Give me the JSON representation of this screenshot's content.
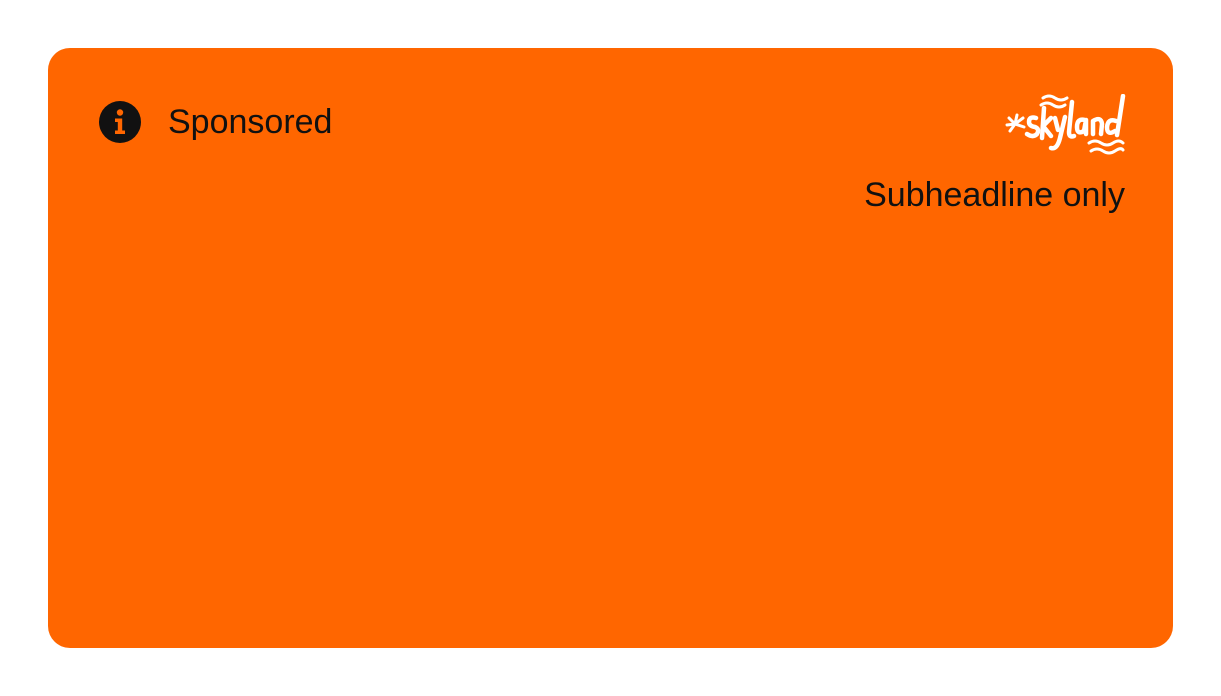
{
  "ad": {
    "sponsored_label": "Sponsored",
    "subheadline": "Subheadline only",
    "brand_name": "skyland",
    "info_icon": "info-icon",
    "colors": {
      "background": "#ff6600",
      "text": "#111111",
      "logo": "#ffffff",
      "page": "#ffffff"
    }
  }
}
